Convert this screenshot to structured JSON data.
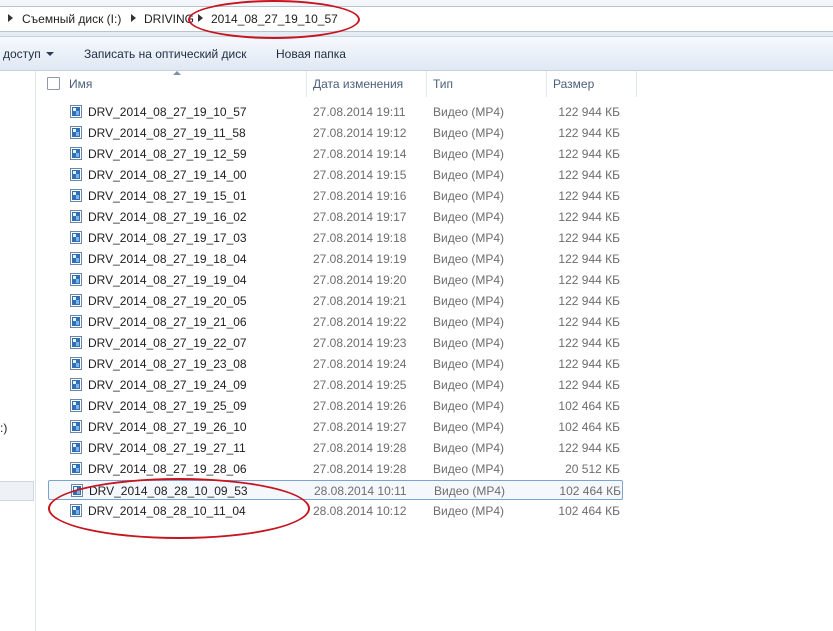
{
  "address_bar": {
    "crumbs": [
      "Съемный диск (I:)",
      "DRIVING",
      "2014_08_27_19_10_57"
    ]
  },
  "toolbar": {
    "share_label": "доступ",
    "burn_label": "Записать на оптический диск",
    "new_folder_label": "Новая папка"
  },
  "nav": {
    "fragment": ":)"
  },
  "columns": {
    "name": "Имя",
    "date": "Дата изменения",
    "type": "Тип",
    "size": "Размер"
  },
  "files": [
    {
      "name": "DRV_2014_08_27_19_10_57",
      "date": "27.08.2014 19:11",
      "type": "Видео (MP4)",
      "size": "122 944 КБ"
    },
    {
      "name": "DRV_2014_08_27_19_11_58",
      "date": "27.08.2014 19:12",
      "type": "Видео (MP4)",
      "size": "122 944 КБ"
    },
    {
      "name": "DRV_2014_08_27_19_12_59",
      "date": "27.08.2014 19:14",
      "type": "Видео (MP4)",
      "size": "122 944 КБ"
    },
    {
      "name": "DRV_2014_08_27_19_14_00",
      "date": "27.08.2014 19:15",
      "type": "Видео (MP4)",
      "size": "122 944 КБ"
    },
    {
      "name": "DRV_2014_08_27_19_15_01",
      "date": "27.08.2014 19:16",
      "type": "Видео (MP4)",
      "size": "122 944 КБ"
    },
    {
      "name": "DRV_2014_08_27_19_16_02",
      "date": "27.08.2014 19:17",
      "type": "Видео (MP4)",
      "size": "122 944 КБ"
    },
    {
      "name": "DRV_2014_08_27_19_17_03",
      "date": "27.08.2014 19:18",
      "type": "Видео (MP4)",
      "size": "122 944 КБ"
    },
    {
      "name": "DRV_2014_08_27_19_18_04",
      "date": "27.08.2014 19:19",
      "type": "Видео (MP4)",
      "size": "122 944 КБ"
    },
    {
      "name": "DRV_2014_08_27_19_19_04",
      "date": "27.08.2014 19:20",
      "type": "Видео (MP4)",
      "size": "122 944 КБ"
    },
    {
      "name": "DRV_2014_08_27_19_20_05",
      "date": "27.08.2014 19:21",
      "type": "Видео (MP4)",
      "size": "122 944 КБ"
    },
    {
      "name": "DRV_2014_08_27_19_21_06",
      "date": "27.08.2014 19:22",
      "type": "Видео (MP4)",
      "size": "122 944 КБ"
    },
    {
      "name": "DRV_2014_08_27_19_22_07",
      "date": "27.08.2014 19:23",
      "type": "Видео (MP4)",
      "size": "122 944 КБ"
    },
    {
      "name": "DRV_2014_08_27_19_23_08",
      "date": "27.08.2014 19:24",
      "type": "Видео (MP4)",
      "size": "122 944 КБ"
    },
    {
      "name": "DRV_2014_08_27_19_24_09",
      "date": "27.08.2014 19:25",
      "type": "Видео (MP4)",
      "size": "122 944 КБ"
    },
    {
      "name": "DRV_2014_08_27_19_25_09",
      "date": "27.08.2014 19:26",
      "type": "Видео (MP4)",
      "size": "102 464 КБ"
    },
    {
      "name": "DRV_2014_08_27_19_26_10",
      "date": "27.08.2014 19:27",
      "type": "Видео (MP4)",
      "size": "102 464 КБ"
    },
    {
      "name": "DRV_2014_08_27_19_27_11",
      "date": "27.08.2014 19:28",
      "type": "Видео (MP4)",
      "size": "122 944 КБ"
    },
    {
      "name": "DRV_2014_08_27_19_28_06",
      "date": "27.08.2014 19:28",
      "type": "Видео (MP4)",
      "size": "20 512 КБ"
    },
    {
      "name": "DRV_2014_08_28_10_09_53",
      "date": "28.08.2014 10:11",
      "type": "Видео (MP4)",
      "size": "102 464 КБ",
      "selected": true
    },
    {
      "name": "DRV_2014_08_28_10_11_04",
      "date": "28.08.2014 10:12",
      "type": "Видео (MP4)",
      "size": "102 464 КБ"
    }
  ],
  "colors": {
    "annotation_red": "#c7151f",
    "selection_border": "#7da2ce",
    "header_text": "#4c607a"
  },
  "icons": {
    "file": "video-file-icon",
    "breadcrumb_separator": "chevron-right-icon"
  }
}
